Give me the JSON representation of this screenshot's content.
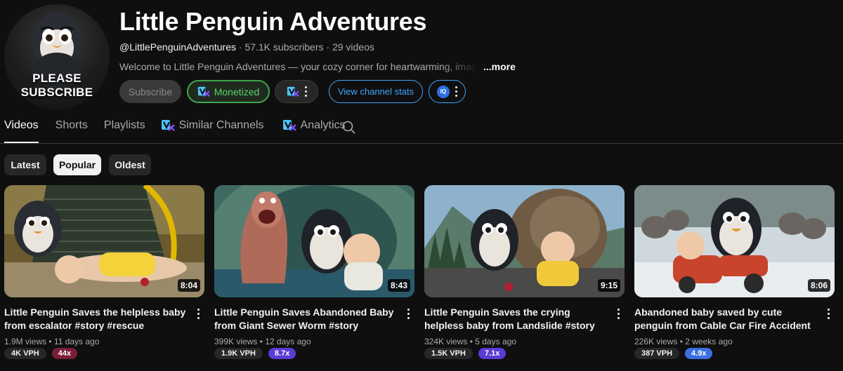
{
  "channel": {
    "title": "Little Penguin Adventures",
    "handle": "@LittlePenguinAdventures",
    "subscribers": "57.1K subscribers",
    "videos": "29 videos",
    "separator": " · ",
    "description": "Welcome to Little Penguin Adventures — your cozy corner for heartwarming, imaginative",
    "more_label": "...more",
    "avatar_text_line1": "PLEASE",
    "avatar_text_line2": "SUBSCRIBE"
  },
  "buttons": {
    "subscribe": "Subscribe",
    "monetized": "Monetized",
    "view_stats": "View channel stats",
    "iq_badge": "IQ"
  },
  "tabs": [
    {
      "label": "Videos",
      "active": true
    },
    {
      "label": "Shorts",
      "active": false
    },
    {
      "label": "Playlists",
      "active": false
    },
    {
      "label": "Similar Channels",
      "active": false
    },
    {
      "label": "Analytics",
      "active": false
    }
  ],
  "chips": [
    {
      "label": "Latest",
      "selected": false
    },
    {
      "label": "Popular",
      "selected": true
    },
    {
      "label": "Oldest",
      "selected": false
    }
  ],
  "videos": [
    {
      "title": "Little Penguin Saves the helpless baby from escalator #story #rescue #animalrescue",
      "duration": "8:04",
      "views": "1.9M views",
      "age": "11 days ago",
      "vph": "4K VPH",
      "multiplier": "44x",
      "multiplier_color": "#7a1e37"
    },
    {
      "title": "Little Penguin Saves Abandoned Baby from Giant Sewer Worm #story #rescue…",
      "duration": "8:43",
      "views": "399K views",
      "age": "12 days ago",
      "vph": "1.9K VPH",
      "multiplier": "8.7x",
      "multiplier_color": "#5b3bd6"
    },
    {
      "title": "Little Penguin Saves the crying helpless baby from Landslide #story #rescue…",
      "duration": "9:15",
      "views": "324K views",
      "age": "5 days ago",
      "vph": "1.5K VPH",
      "multiplier": "7.1x",
      "multiplier_color": "#5b3bd6"
    },
    {
      "title": "Abandoned baby saved by cute penguin from Cable Car Fire Accident #story #rescu…",
      "duration": "8:06",
      "views": "226K views",
      "age": "2 weeks ago",
      "vph": "387 VPH",
      "multiplier": "4.9x",
      "multiplier_color": "#3b6fe0"
    }
  ],
  "colors": {
    "background": "#0f0f0f",
    "accent_blue": "#3ea6ff",
    "monetized_green": "#3ea64a"
  },
  "icons": {
    "extension": "vidiq-logo-icon",
    "menu": "more-vert-icon",
    "search": "search-icon"
  }
}
